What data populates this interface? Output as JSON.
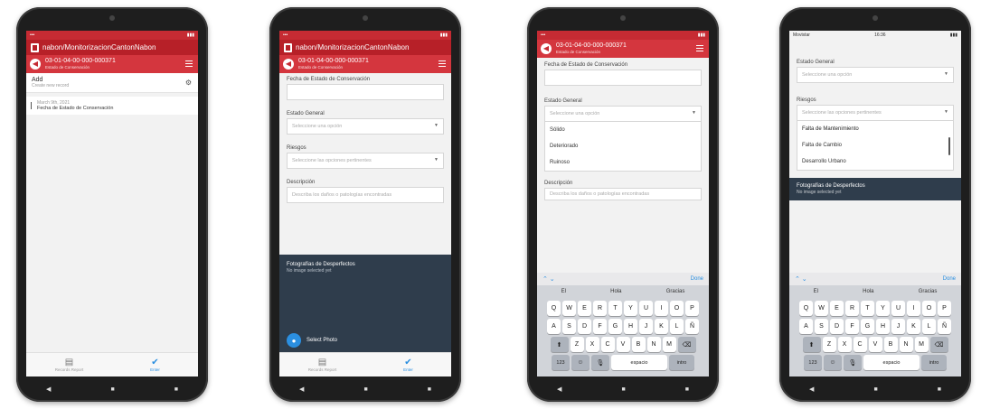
{
  "screen1": {
    "app_title": "nabon/MonitorizacionCantonNabon",
    "subheader": "03-01-04-00-000-000371",
    "subheader_caption": "Estado de Conservación",
    "add_title": "Add",
    "add_subtitle": "Create new record",
    "record_date": "March 9th, 2021",
    "record_label": "Fecha de Estado de Conservación",
    "nav_left": "Records Report",
    "nav_right": "Enter"
  },
  "screen2": {
    "app_title": "nabon/MonitorizacionCantonNabon",
    "subheader": "03-01-04-00-000-000371",
    "subheader_caption": "Estado de Conservación",
    "field1_label": "Fecha de Estado de Conservación",
    "field2_label": "Estado General",
    "field2_placeholder": "Seleccione una opción",
    "field3_label": "Riesgos",
    "field3_placeholder": "Seleccione las opciones pertinentes",
    "field4_label": "Descripción",
    "field4_placeholder": "Describa los daños o patologías encontradas",
    "photos_title": "Fotografías de Desperfectos",
    "photos_subtitle": "No image selected yet",
    "select_photo": "Select Photo",
    "nav_left": "Records Report",
    "nav_right": "Enter"
  },
  "screen3": {
    "subheader": "03-01-04-00-000-000371",
    "subheader_caption": "Estado de Conservación",
    "field1_label": "Fecha de Estado de Conservación",
    "field2_label": "Estado General",
    "field2_placeholder": "Seleccione una opción",
    "options": [
      "Sólido",
      "Deteriorado",
      "Ruinoso"
    ],
    "field4_label": "Descripción",
    "field4_placeholder": "Describa los daños o patologías encontradas",
    "done": "Done",
    "suggestions": [
      "El",
      "Hola",
      "Gracias"
    ],
    "space": "espacio",
    "return": "intro",
    "numkey": "123"
  },
  "screen4": {
    "status_carrier": "Movistar",
    "status_time": "16:36",
    "field2_label": "Estado General",
    "field2_placeholder": "Seleccione una opción",
    "field3_label": "Riesgos",
    "field3_placeholder": "Seleccione las opciones pertinentes",
    "options": [
      "Falta de Mantenimiento",
      "Falta de Cambio",
      "Desarrollo Urbano"
    ],
    "photos_title": "Fotografías de Desperfectos",
    "photos_subtitle": "No image selected yet",
    "done": "Done",
    "suggestions": [
      "El",
      "Hola",
      "Gracias"
    ],
    "space": "espacio",
    "return": "intro",
    "numkey": "123"
  },
  "keyboard_rows": [
    [
      "Q",
      "W",
      "E",
      "R",
      "T",
      "Y",
      "U",
      "I",
      "O",
      "P"
    ],
    [
      "A",
      "S",
      "D",
      "F",
      "G",
      "H",
      "J",
      "K",
      "L",
      "Ñ"
    ],
    [
      "Z",
      "X",
      "C",
      "V",
      "B",
      "N",
      "M"
    ]
  ]
}
